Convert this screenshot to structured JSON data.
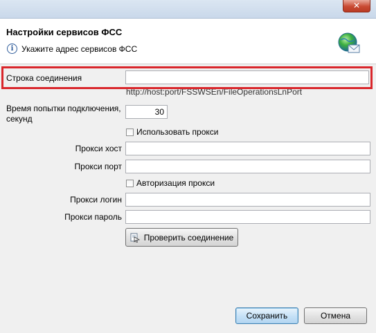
{
  "window": {
    "title": "Настройки сервисов ФСС",
    "close_label": "✕"
  },
  "header": {
    "title": "Настройки сервисов ФСС",
    "message": "Укажите адрес сервисов ФСС",
    "info_icon": "info-icon",
    "decor_icon": "globe-mail-icon"
  },
  "form": {
    "connection_label": "Строка соединения",
    "connection_value": "",
    "connection_hint": "http://host:port/FSSWSEn/FileOperationsLnPort",
    "timeout_label_1": "Время попытки подключения,",
    "timeout_label_2": "секунд",
    "timeout_value": "30",
    "use_proxy_label": "Использовать прокси",
    "use_proxy_checked": false,
    "proxy_host_label": "Прокси хост",
    "proxy_host_value": "",
    "proxy_port_label": "Прокси порт",
    "proxy_port_value": "",
    "proxy_auth_label": "Авторизация прокси",
    "proxy_auth_checked": false,
    "proxy_login_label": "Прокси логин",
    "proxy_login_value": "",
    "proxy_password_label": "Прокси пароль",
    "proxy_password_value": "",
    "test_button_label": "Проверить соединение"
  },
  "footer": {
    "save_label": "Сохранить",
    "cancel_label": "Отмена"
  },
  "colors": {
    "highlight": "#d9262b",
    "default_button_border": "#3c7fb1"
  }
}
